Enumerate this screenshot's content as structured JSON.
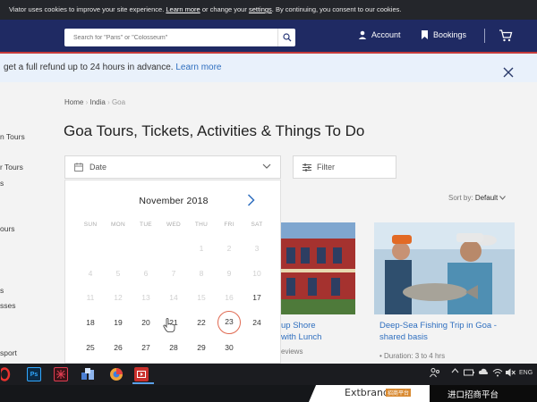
{
  "cookie_bar": {
    "text_a": "Viator uses cookies to improve your site experience. ",
    "learn_more": "Learn more",
    "text_b": " or change your ",
    "settings": "settings",
    "text_c": ". By continuing, you consent to our cookies."
  },
  "header": {
    "search_placeholder": "Search for \"Paris\" or \"Colosseum\"",
    "account_label": "Account",
    "bookings_label": "Bookings"
  },
  "refund_banner": {
    "text": "get a full refund up to 24 hours in advance.",
    "link": "Learn more"
  },
  "sidebar": {
    "items": [
      "n Tours",
      "r Tours",
      "s",
      "ours",
      "s",
      "sses",
      "sport"
    ]
  },
  "breadcrumb": [
    "Home",
    "India",
    "Goa"
  ],
  "page_title": "Goa Tours, Tickets, Activities & Things To Do",
  "date_filter": {
    "label": "Date"
  },
  "filter_button": {
    "label": "Filter"
  },
  "sort": {
    "label": "Sort by:",
    "value": "Default"
  },
  "calendar": {
    "month": "November",
    "year": "2018",
    "weekdays": [
      "SUN",
      "MON",
      "TUE",
      "WED",
      "THU",
      "FRI",
      "SAT"
    ],
    "weeks": [
      [
        {
          "d": "",
          "p": false
        },
        {
          "d": "",
          "p": false
        },
        {
          "d": "",
          "p": false
        },
        {
          "d": "",
          "p": false
        },
        {
          "d": "1",
          "p": true
        },
        {
          "d": "2",
          "p": true
        },
        {
          "d": "3",
          "p": true
        }
      ],
      [
        {
          "d": "4",
          "p": true
        },
        {
          "d": "5",
          "p": true
        },
        {
          "d": "6",
          "p": true
        },
        {
          "d": "7",
          "p": true
        },
        {
          "d": "8",
          "p": true
        },
        {
          "d": "9",
          "p": true
        },
        {
          "d": "10",
          "p": true
        }
      ],
      [
        {
          "d": "11",
          "p": true
        },
        {
          "d": "12",
          "p": true
        },
        {
          "d": "13",
          "p": true
        },
        {
          "d": "14",
          "p": true
        },
        {
          "d": "15",
          "p": true
        },
        {
          "d": "16",
          "p": true
        },
        {
          "d": "17",
          "p": false
        }
      ],
      [
        {
          "d": "18",
          "p": false
        },
        {
          "d": "19",
          "p": false
        },
        {
          "d": "20",
          "p": false
        },
        {
          "d": "21",
          "p": false
        },
        {
          "d": "22",
          "p": false
        },
        {
          "d": "23",
          "p": false
        },
        {
          "d": "24",
          "p": false
        }
      ],
      [
        {
          "d": "25",
          "p": false
        },
        {
          "d": "26",
          "p": false
        },
        {
          "d": "27",
          "p": false
        },
        {
          "d": "28",
          "p": false
        },
        {
          "d": "29",
          "p": false
        },
        {
          "d": "30",
          "p": false
        },
        {
          "d": "",
          "p": false
        }
      ]
    ],
    "selected_day": "23"
  },
  "cards": [
    {
      "title_line1": "up Shore",
      "title_line2": "with Lunch",
      "sub": "eviews"
    },
    {
      "title_line1": "Deep-Sea Fishing Trip in Goa -",
      "title_line2": "shared basis",
      "sub": "Duration: 3 to 4 hrs"
    }
  ],
  "taskbar": {
    "ps_label": "Ps",
    "lang": "ENG"
  },
  "watermark": {
    "brand": "Extbrand",
    "tag": "招商平台",
    "text": "进口招商平台"
  }
}
